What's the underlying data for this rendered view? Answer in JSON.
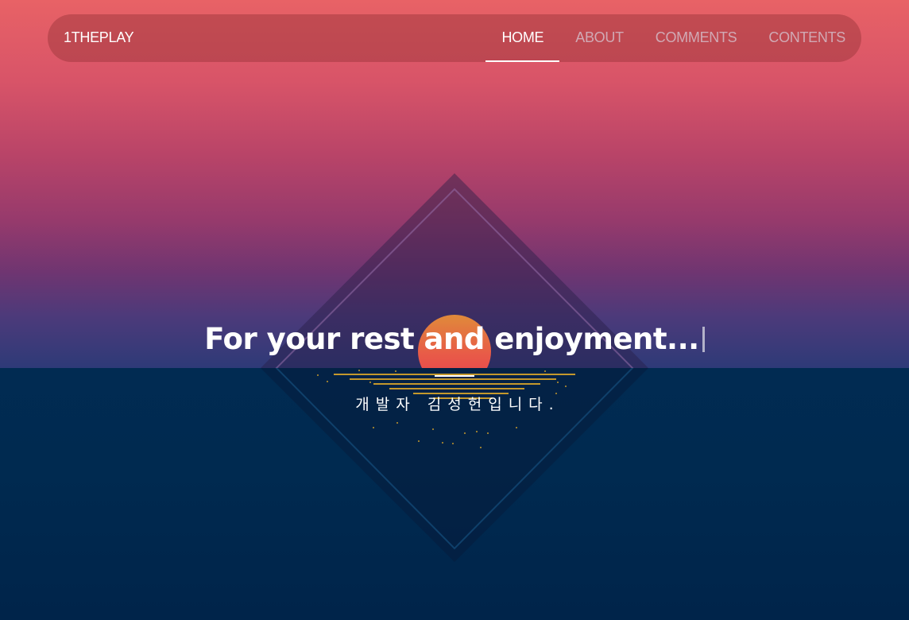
{
  "navbar": {
    "brand": "1THEPLAY",
    "items": [
      {
        "label": "HOME",
        "active": true
      },
      {
        "label": "ABOUT",
        "active": false
      },
      {
        "label": "COMMENTS",
        "active": false
      },
      {
        "label": "CONTENTS",
        "active": false
      }
    ]
  },
  "hero": {
    "headline": "For your rest and enjoyment...",
    "subtitle": "개발자 김성헌입니다."
  },
  "colors": {
    "sky_top": "#e86266",
    "sky_bottom": "#2e3a78",
    "sea": "#002a50",
    "sun": "#e8603c",
    "reflection": "#d9a52a"
  },
  "icons": {
    "logo_art": "diamond-sunset-logo"
  }
}
